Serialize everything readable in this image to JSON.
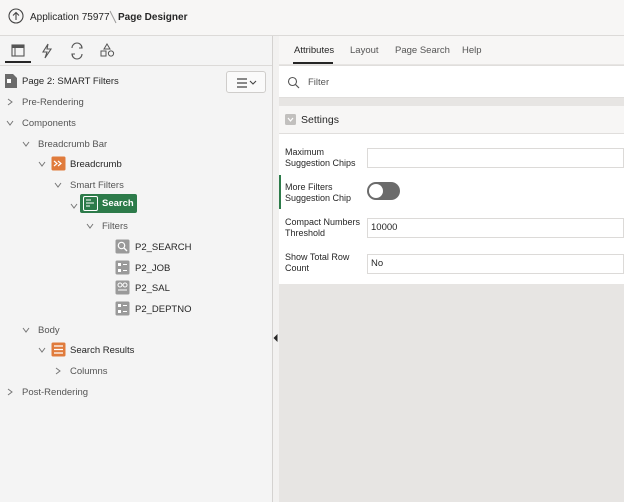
{
  "header": {
    "app_title": "Application 75977",
    "page_title": "Page Designer"
  },
  "left_panel": {
    "tabs": [
      {
        "name": "rendering-tab",
        "icon": "tree-icon",
        "active": true
      },
      {
        "name": "dynamic-actions-tab",
        "icon": "lightning-icon"
      },
      {
        "name": "processing-tab",
        "icon": "cycle-icon"
      },
      {
        "name": "shared-components-tab",
        "icon": "shapes-icon"
      }
    ],
    "page_label": "Page 2: SMART Filters",
    "tree": {
      "pre_rendering": "Pre-Rendering",
      "components": "Components",
      "breadcrumb_bar": "Breadcrumb Bar",
      "breadcrumb": "Breadcrumb",
      "smart_filters": "Smart Filters",
      "search": "Search",
      "filters": "Filters",
      "p2_search": "P2_SEARCH",
      "p2_job": "P2_JOB",
      "p2_sal": "P2_SAL",
      "p2_deptno": "P2_DEPTNO",
      "body": "Body",
      "search_results": "Search Results",
      "columns": "Columns",
      "post_rendering": "Post-Rendering"
    }
  },
  "right_panel": {
    "tabs": [
      "Attributes",
      "Layout",
      "Page Search",
      "Help"
    ],
    "active_tab": "Attributes",
    "filter_placeholder": "Filter",
    "settings_title": "Settings",
    "props": {
      "max_chips_label_1": "Maximum",
      "max_chips_label_2": "Suggestion Chips",
      "max_chips_value": "",
      "more_filters_label_1": "More Filters",
      "more_filters_label_2": "Suggestion Chip",
      "more_filters_on": false,
      "compact_label_1": "Compact Numbers",
      "compact_label_2": "Threshold",
      "compact_value": "10000",
      "total_label_1": "Show Total Row",
      "total_label_2": "Count",
      "total_value": "No"
    }
  },
  "colors": {
    "accent_green": "#2d7b4a",
    "icon_orange": "#e07b3c",
    "icon_gray": "#8a8a8a"
  }
}
